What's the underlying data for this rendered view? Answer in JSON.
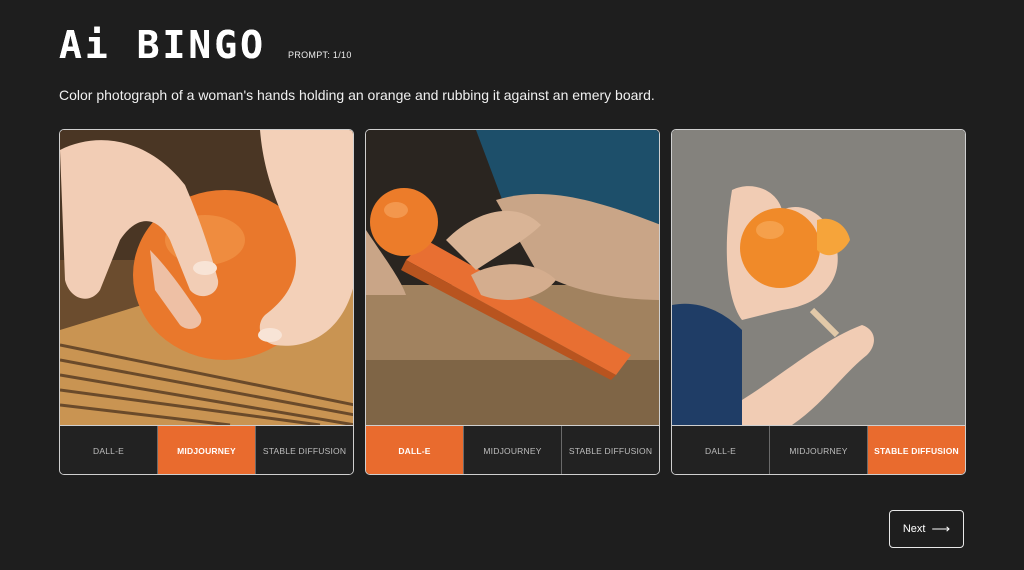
{
  "app": {
    "logo": "Ai BINGO",
    "prompt_counter": "PROMPT: 1/10",
    "prompt_text": "Color photograph of a woman's hands holding an orange and rubbing it against an emery board."
  },
  "cards": [
    {
      "options": [
        "DALL-E",
        "MIDJOURNEY",
        "STABLE DIFFUSION"
      ],
      "selected": "MIDJOURNEY"
    },
    {
      "options": [
        "DALL-E",
        "MIDJOURNEY",
        "STABLE DIFFUSION"
      ],
      "selected": "DALL-E"
    },
    {
      "options": [
        "DALL-E",
        "MIDJOURNEY",
        "STABLE DIFFUSION"
      ],
      "selected": "STABLE DIFFUSION"
    }
  ],
  "next_button": {
    "label": "Next",
    "icon": "long-arrow-right-icon"
  },
  "colors": {
    "accent": "#e96b2e",
    "background": "#1e1e1e"
  }
}
